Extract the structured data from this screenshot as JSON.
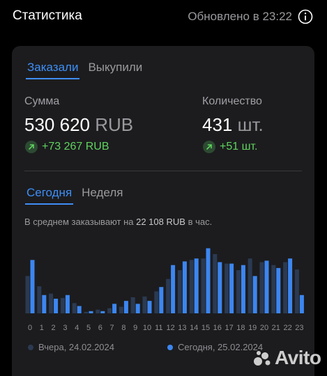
{
  "header": {
    "title": "Статистика",
    "updated": "Обновлено в 23:22",
    "info_icon": "info-circle-icon"
  },
  "tabs": [
    {
      "label": "Заказали",
      "active": true
    },
    {
      "label": "Выкупили",
      "active": false
    }
  ],
  "metrics": {
    "sum": {
      "label": "Сумма",
      "value": "530 620",
      "unit": "RUB",
      "delta": "+73 267 RUB",
      "delta_icon": "arrow-up-right-icon"
    },
    "count": {
      "label": "Количество",
      "value": "431",
      "unit": "шт.",
      "delta": "+51 шт.",
      "delta_icon": "arrow-up-right-icon"
    }
  },
  "period_tabs": [
    {
      "label": "Сегодня",
      "active": true
    },
    {
      "label": "Неделя",
      "active": false
    }
  ],
  "average": {
    "prefix": "В среднем заказывают на",
    "amount": "22 108 RUB",
    "suffix": "в час."
  },
  "colors": {
    "accent": "#3e8ef7",
    "today": "#3c86f0",
    "yesterday": "#2b3a52",
    "positive": "#5fd35f",
    "card": "#1c1c1e"
  },
  "chart_data": {
    "type": "bar",
    "categories": [
      "0",
      "1",
      "2",
      "3",
      "4",
      "5",
      "6",
      "7",
      "8",
      "9",
      "10",
      "11",
      "12",
      "13",
      "14",
      "15",
      "16",
      "17",
      "18",
      "19",
      "20",
      "21",
      "22",
      "23"
    ],
    "series": [
      {
        "name": "Вчера, 24.02.2024",
        "values": [
          51,
          37,
          27,
          21,
          14,
          2,
          5,
          7,
          9,
          22,
          23,
          30,
          47,
          59,
          73,
          75,
          81,
          68,
          59,
          75,
          70,
          66,
          70,
          60
        ]
      },
      {
        "name": "Сегодня, 25.02.2024",
        "values": [
          73,
          25,
          20,
          25,
          10,
          3,
          3,
          13,
          17,
          13,
          17,
          36,
          66,
          71,
          75,
          89,
          70,
          68,
          66,
          51,
          72,
          62,
          75,
          25
        ]
      }
    ],
    "ylim": [
      0,
      100
    ],
    "grid": false,
    "legend": "bottom"
  },
  "legend": [
    {
      "label": "Вчера, 24.02.2024",
      "color": "#2b3a52"
    },
    {
      "label": "Сегодня, 25.02.2024",
      "color": "#3c86f0"
    }
  ],
  "watermark": {
    "text": "Avito"
  }
}
